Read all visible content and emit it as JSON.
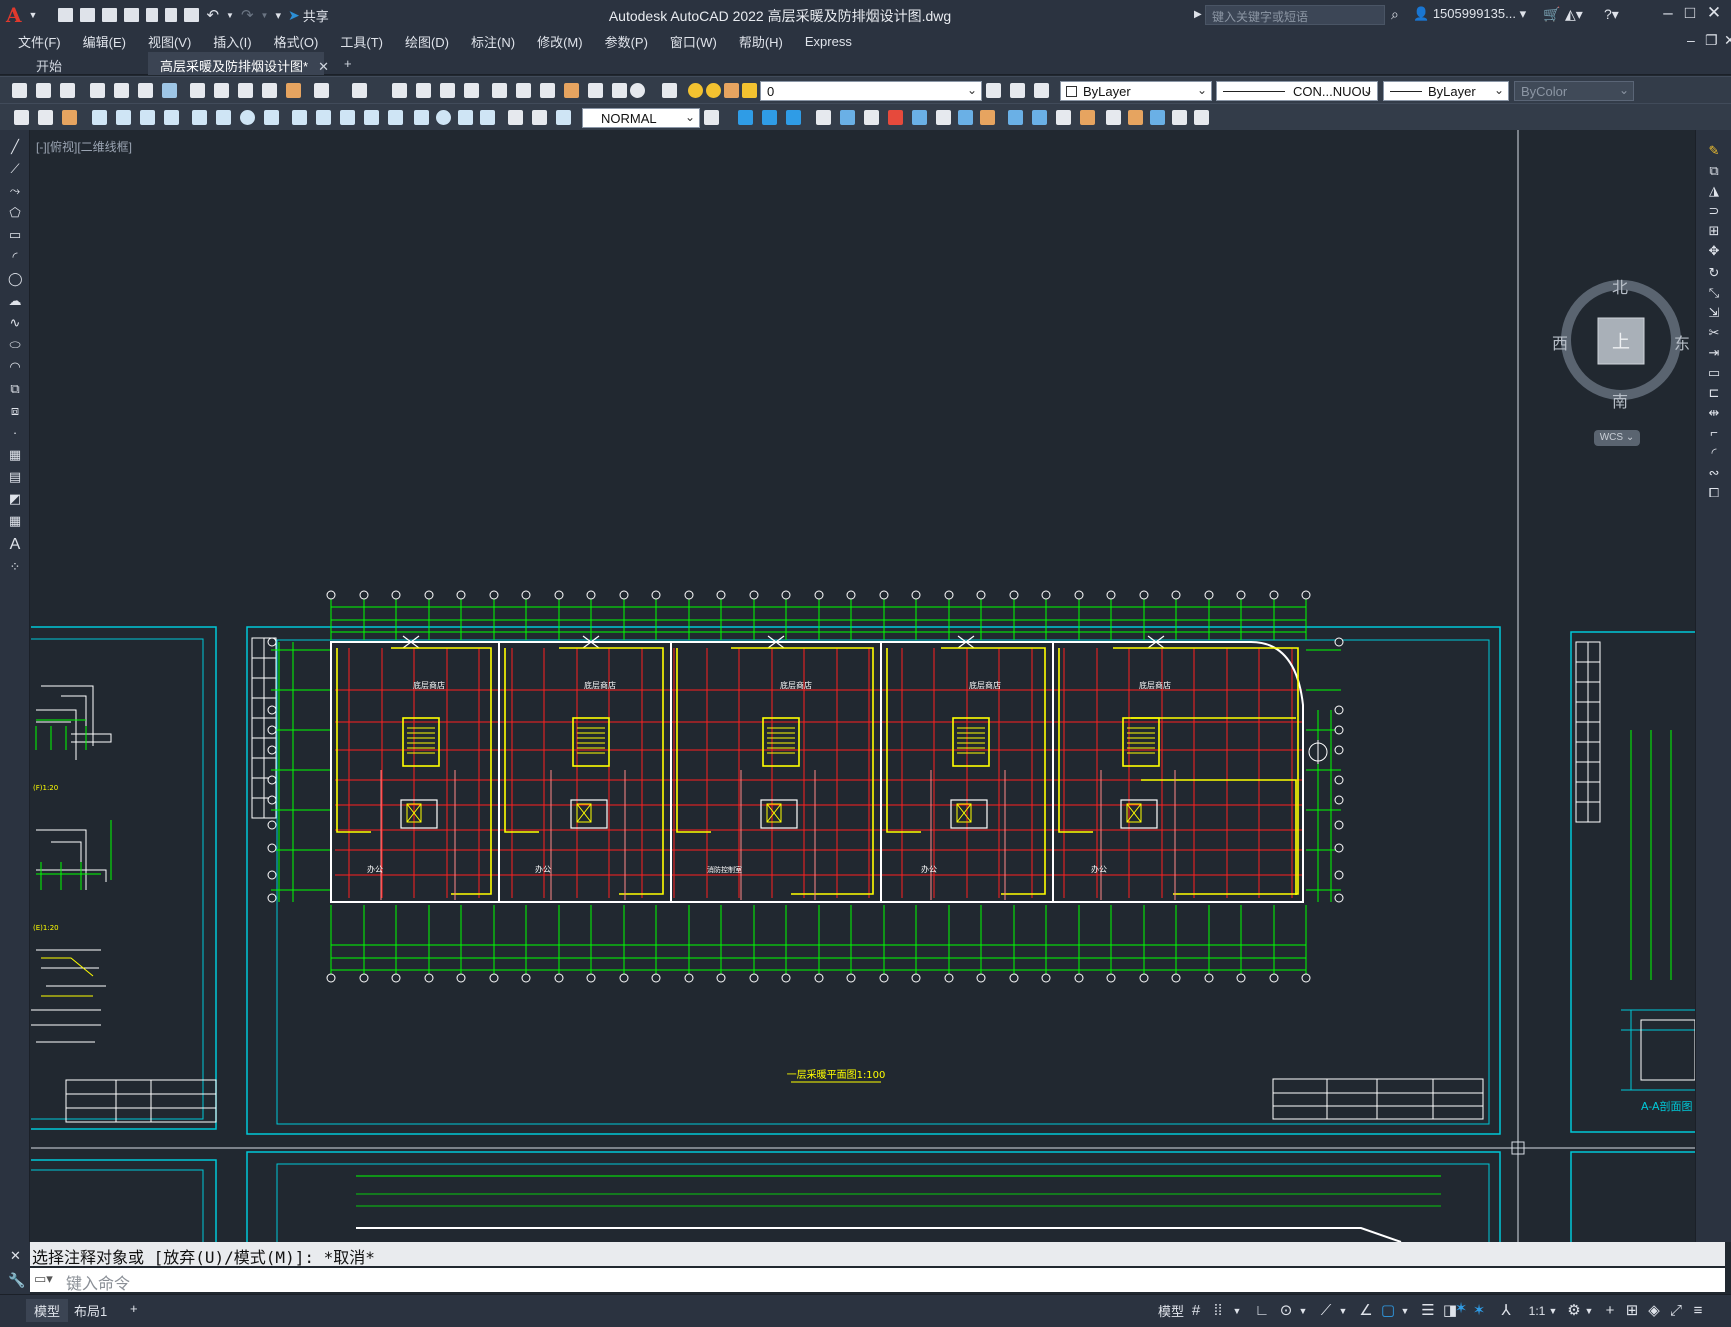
{
  "app": {
    "title": "Autodesk AutoCAD 2022    高层采暖及防排烟设计图.dwg",
    "search_placeholder": "键入关键字或短语",
    "user": "1505999135...",
    "share_label": "共享",
    "logo": "A"
  },
  "menu": [
    "文件(F)",
    "编辑(E)",
    "视图(V)",
    "插入(I)",
    "格式(O)",
    "工具(T)",
    "绘图(D)",
    "标注(N)",
    "修改(M)",
    "参数(P)",
    "窗口(W)",
    "帮助(H)",
    "Express"
  ],
  "tabs": [
    {
      "label": "开始",
      "active": false
    },
    {
      "label": "高层采暖及防排烟设计图*",
      "active": true
    }
  ],
  "tab_new": "+",
  "ribbon": {
    "layer_value": "0",
    "color_value": "ByLayer",
    "linetype_value": "CON...NUOU",
    "lineweight_value": "ByLayer",
    "plotstyle_value": "ByColor",
    "dimstyle_value": "NORMAL"
  },
  "viewport": {
    "label": "[-][俯视][二维线框]",
    "viewcube": {
      "north": "北",
      "south": "南",
      "east": "东",
      "west": "西",
      "face": "上",
      "ucs": "WCS"
    }
  },
  "drawing": {
    "main_title": "一层采暖平面图1:100",
    "shop_label": "底层商店",
    "office_label": "办公",
    "fire_room_label": "消防控制室",
    "left_labels": [
      "(F)1:20",
      "(E)1:20"
    ],
    "right_section_label": "A-A剖面图"
  },
  "command": {
    "history": "选择注释对象或 [放弃(U)/模式(M)]: *取消*",
    "placeholder": "键入命令"
  },
  "status": {
    "layout_tabs": [
      "模型",
      "布局1"
    ],
    "add_tab": "+",
    "scale": "1:1"
  },
  "colors": {
    "background": "#212830",
    "panel": "#2b3340",
    "wall": "#ffff00",
    "grid": "#ff1f1f",
    "axis": "#00ff00",
    "frame": "#00c8d7",
    "detail": "#ffffff",
    "accent": "#2f9ce6"
  }
}
